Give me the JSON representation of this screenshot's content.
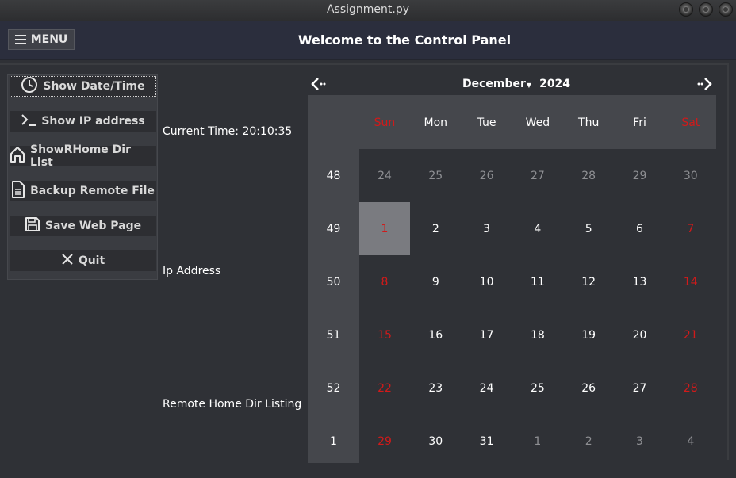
{
  "window": {
    "title": "Assignment.py"
  },
  "header": {
    "menu_label": "MENU",
    "title": "Welcome to the Control Panel"
  },
  "sidebar": {
    "buttons": [
      {
        "label": "Show Date/Time",
        "icon": "clock-icon"
      },
      {
        "label": "Show IP address",
        "icon": "terminal-icon"
      },
      {
        "label": "ShowRHome Dir List",
        "icon": "home-icon"
      },
      {
        "label": "Backup Remote File",
        "icon": "document-icon"
      },
      {
        "label": "Save Web Page",
        "icon": "save-icon"
      },
      {
        "label": "Quit",
        "icon": "close-icon"
      }
    ]
  },
  "labels": {
    "current_time": "Current Time: 20:10:35",
    "ip_address": "Ip Address",
    "remote_home": "Remote Home Dir Listing"
  },
  "calendar": {
    "month": "December",
    "year": "2024",
    "weekdays": [
      "Sun",
      "Mon",
      "Tue",
      "Wed",
      "Thu",
      "Fri",
      "Sat"
    ],
    "weeks": [
      {
        "week": "48",
        "days": [
          "24",
          "25",
          "26",
          "27",
          "28",
          "29",
          "30"
        ]
      },
      {
        "week": "49",
        "days": [
          "1",
          "2",
          "3",
          "4",
          "5",
          "6",
          "7"
        ]
      },
      {
        "week": "50",
        "days": [
          "8",
          "9",
          "10",
          "11",
          "12",
          "13",
          "14"
        ]
      },
      {
        "week": "51",
        "days": [
          "15",
          "16",
          "17",
          "18",
          "19",
          "20",
          "21"
        ]
      },
      {
        "week": "52",
        "days": [
          "22",
          "23",
          "24",
          "25",
          "26",
          "27",
          "28"
        ]
      },
      {
        "week": "1",
        "days": [
          "29",
          "30",
          "31",
          "1",
          "2",
          "3",
          "4"
        ]
      }
    ],
    "selected_day": "1",
    "colors": {
      "weekend": "#d11a1a",
      "other_month": "#8e8f93",
      "selected_bg": "#7a7b80"
    }
  }
}
